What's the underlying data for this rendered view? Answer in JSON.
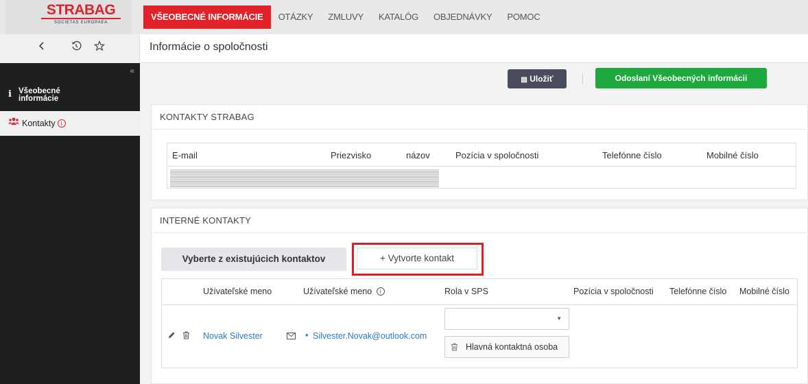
{
  "logo": {
    "main": "STRABAG",
    "sub": "SOCIETAS EUROPAEA"
  },
  "nav": [
    {
      "label": "VŠEOBECNÉ INFORMÁCIE",
      "active": true
    },
    {
      "label": "OTÁZKY",
      "active": false
    },
    {
      "label": "ZMLUVY",
      "active": false
    },
    {
      "label": "KATALÓG",
      "active": false
    },
    {
      "label": "OBJEDNÁVKY",
      "active": false
    },
    {
      "label": "POMOC",
      "active": false
    }
  ],
  "controls": {
    "back_icon": "chevron-left-icon",
    "history_icon": "history-icon",
    "star_icon": "star-icon"
  },
  "page_title": "Informácie o spoločnosti",
  "sidebar": {
    "collapse_icon": "double-chevron-left-icon",
    "items": [
      {
        "label": "Všeobecné informácie",
        "icon": "info-icon"
      },
      {
        "label": "Kontakty",
        "icon": "users-icon",
        "warning": "i"
      }
    ]
  },
  "toolbar": {
    "save_label": "Uložiť",
    "send_label": "Odoslaní Všeobecných informácii"
  },
  "strabag_contacts": {
    "title": "KONTAKTY STRABAG",
    "columns": [
      "E-mail",
      "Priezvisko",
      "názov",
      "Pozícia v spoločnosti",
      "Telefónne číslo",
      "Mobilné číslo"
    ]
  },
  "internal_contacts": {
    "title": "INTERNÉ KONTAKTY",
    "choose_label": "Vyberte z existujúcich kontaktov",
    "create_label": "+ Vytvorte kontakt",
    "columns": [
      "Užívateľské meno",
      "Užívateľské meno",
      "Rola v SPS",
      "Pozícia v spoločnosti",
      "Telefónne číslo",
      "Mobilné číslo"
    ],
    "rows": [
      {
        "name": "Novak Silvester",
        "email": "Silvester.Novak@outlook.com",
        "role": "",
        "main_contact_label": "Hlavná kontaktná osoba"
      }
    ]
  },
  "colors": {
    "brand_red": "#e22129",
    "save_bg": "#484c5c",
    "send_bg": "#1ea93f",
    "sidebar_bg": "#1f1f1f",
    "link": "#2b7bbf"
  }
}
